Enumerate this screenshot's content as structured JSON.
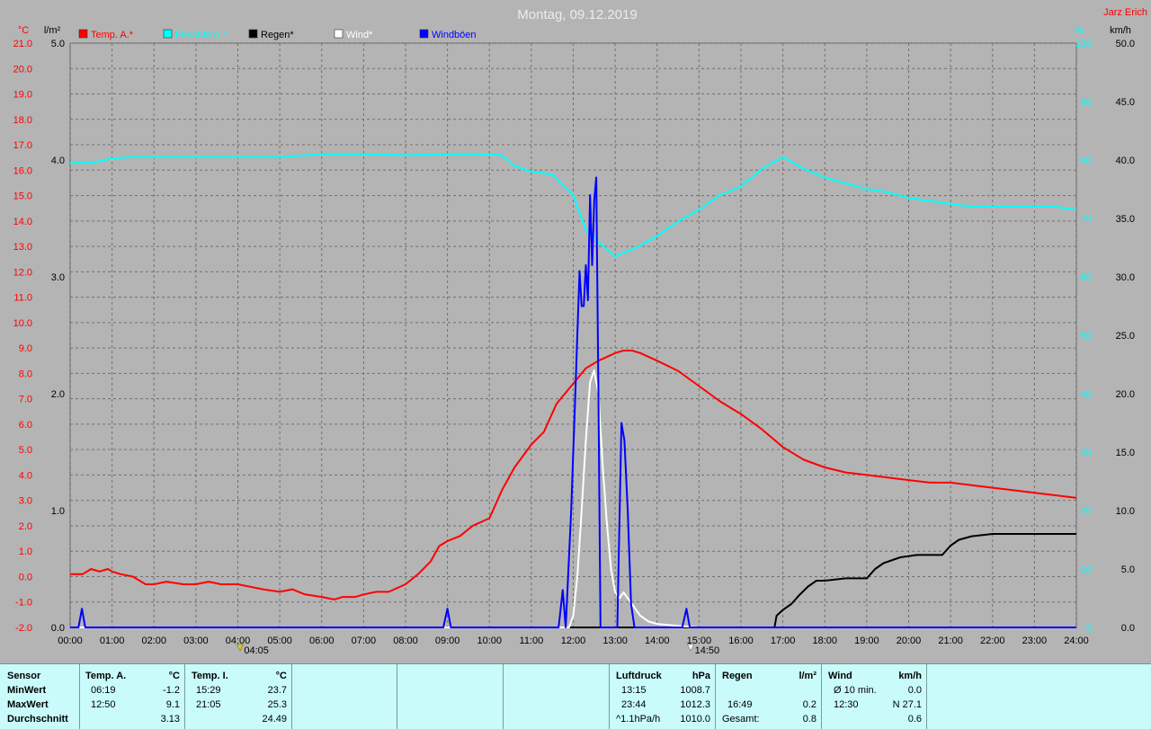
{
  "header": {
    "title": "Montag, 09.12.2019",
    "author": "Jarz Erich"
  },
  "axes": {
    "left1_unit": "°C",
    "left2_unit": "l/m²",
    "right1_unit": "%",
    "right2_unit": "km/h"
  },
  "legend": [
    {
      "label": "Temp. A.*",
      "color": "#ff0000"
    },
    {
      "label": "Feuchte A.*",
      "color": "#00ffff"
    },
    {
      "label": "Regen*",
      "color": "#000000"
    },
    {
      "label": "Wind*",
      "color": "#ffffff"
    },
    {
      "label": "Windböen",
      "color": "#0000ff"
    }
  ],
  "markers": {
    "sunrise": "04:05",
    "sunset": "14:50"
  },
  "chart_data": {
    "type": "line",
    "x_unit": "hour",
    "xlim": [
      0,
      24
    ],
    "x_ticks": [
      "00:00",
      "01:00",
      "02:00",
      "03:00",
      "04:00",
      "05:00",
      "06:00",
      "07:00",
      "08:00",
      "09:00",
      "10:00",
      "11:00",
      "12:00",
      "13:00",
      "14:00",
      "15:00",
      "16:00",
      "17:00",
      "18:00",
      "19:00",
      "20:00",
      "21:00",
      "22:00",
      "23:00",
      "24:00"
    ],
    "axis_temp": {
      "unit": "°C",
      "ylim": [
        -2,
        21
      ],
      "ticks": [
        "-2.0",
        "-1.0",
        "0.0",
        "1.0",
        "2.0",
        "3.0",
        "4.0",
        "5.0",
        "6.0",
        "7.0",
        "8.0",
        "9.0",
        "10.0",
        "11.0",
        "12.0",
        "13.0",
        "14.0",
        "15.0",
        "16.0",
        "17.0",
        "18.0",
        "19.0",
        "20.0",
        "21.0"
      ]
    },
    "axis_rain": {
      "unit": "l/m²",
      "ylim": [
        0,
        5
      ],
      "ticks": [
        "0.0",
        "1.0",
        "2.0",
        "3.0",
        "4.0",
        "5.0"
      ]
    },
    "axis_humidity": {
      "unit": "%",
      "ylim": [
        0,
        100
      ],
      "ticks": [
        "0",
        "10",
        "20",
        "30",
        "40",
        "50",
        "60",
        "70",
        "80",
        "90",
        "100"
      ]
    },
    "axis_wind": {
      "unit": "km/h",
      "ylim": [
        0,
        50
      ],
      "ticks": [
        "0.0",
        "5.0",
        "10.0",
        "15.0",
        "20.0",
        "25.0",
        "30.0",
        "35.0",
        "40.0",
        "45.0",
        "50.0"
      ]
    },
    "series": [
      {
        "name": "Temp. A.*",
        "color": "#ff0000",
        "axis": "axis_temp",
        "x": [
          0,
          0.3,
          0.5,
          0.7,
          0.9,
          1.0,
          1.2,
          1.5,
          1.8,
          2.0,
          2.3,
          2.7,
          3.0,
          3.3,
          3.6,
          4.0,
          4.3,
          4.6,
          5.0,
          5.3,
          5.6,
          6.0,
          6.3,
          6.5,
          6.8,
          7.0,
          7.3,
          7.6,
          8.0,
          8.3,
          8.6,
          8.8,
          9.0,
          9.3,
          9.6,
          10.0,
          10.3,
          10.6,
          11.0,
          11.3,
          11.6,
          12.0,
          12.3,
          12.6,
          13.0,
          13.2,
          13.4,
          13.6,
          14.0,
          14.5,
          15.0,
          15.5,
          16.0,
          16.5,
          17.0,
          17.5,
          18.0,
          18.5,
          19.0,
          19.5,
          20.0,
          20.5,
          21.0,
          21.5,
          22.0,
          22.5,
          23.0,
          23.5,
          24.0
        ],
        "y": [
          0.1,
          0.1,
          0.3,
          0.2,
          0.3,
          0.2,
          0.1,
          0.0,
          -0.3,
          -0.3,
          -0.2,
          -0.3,
          -0.3,
          -0.2,
          -0.3,
          -0.3,
          -0.4,
          -0.5,
          -0.6,
          -0.5,
          -0.7,
          -0.8,
          -0.9,
          -0.8,
          -0.8,
          -0.7,
          -0.6,
          -0.6,
          -0.3,
          0.1,
          0.6,
          1.2,
          1.4,
          1.6,
          2.0,
          2.3,
          3.4,
          4.3,
          5.2,
          5.7,
          6.8,
          7.6,
          8.2,
          8.5,
          8.8,
          8.9,
          8.9,
          8.8,
          8.5,
          8.1,
          7.5,
          6.9,
          6.4,
          5.8,
          5.1,
          4.6,
          4.3,
          4.1,
          4.0,
          3.9,
          3.8,
          3.7,
          3.7,
          3.6,
          3.5,
          3.4,
          3.3,
          3.2,
          3.1
        ]
      },
      {
        "name": "Feuchte A.*",
        "color": "#00ffff",
        "axis": "axis_humidity",
        "x": [
          0,
          0.5,
          1.0,
          1.5,
          2.0,
          3.0,
          4.0,
          5.0,
          6.0,
          6.5,
          7.0,
          8.0,
          9.0,
          10.0,
          10.3,
          10.6,
          11.0,
          11.5,
          12.0,
          12.3,
          12.6,
          13.0,
          13.5,
          14.0,
          14.5,
          15.0,
          15.5,
          16.0,
          16.5,
          17.0,
          17.5,
          18.0,
          18.5,
          19.0,
          19.5,
          20.0,
          20.5,
          21.0,
          21.5,
          22.0,
          22.5,
          23.0,
          23.5,
          24.0
        ],
        "y": [
          79.5,
          79.5,
          80.3,
          80.5,
          80.5,
          80.5,
          80.5,
          80.5,
          81.0,
          81.0,
          81.0,
          80.8,
          81.0,
          81.0,
          80.8,
          79.0,
          78.0,
          77.5,
          74.0,
          68.0,
          66.0,
          63.5,
          65.0,
          67.0,
          69.5,
          71.5,
          74.0,
          75.5,
          78.5,
          80.5,
          78.5,
          77.0,
          76.0,
          75.0,
          74.5,
          73.5,
          73.0,
          72.5,
          72.0,
          72.0,
          72.0,
          72.0,
          72.0,
          71.5
        ]
      },
      {
        "name": "Regen*",
        "color": "#000000",
        "axis": "axis_rain",
        "x": [
          0,
          16.8,
          16.85,
          17.0,
          17.2,
          17.4,
          17.6,
          17.8,
          18.0,
          18.5,
          19.0,
          19.2,
          19.4,
          19.8,
          20.2,
          20.8,
          21.0,
          21.2,
          21.5,
          22.0,
          23.0,
          24.0
        ],
        "y": [
          0,
          0,
          0.1,
          0.15,
          0.2,
          0.28,
          0.35,
          0.4,
          0.4,
          0.42,
          0.42,
          0.5,
          0.55,
          0.6,
          0.62,
          0.62,
          0.7,
          0.75,
          0.78,
          0.8,
          0.8,
          0.8
        ]
      },
      {
        "name": "Wind*",
        "color": "#ffffff",
        "axis": "axis_wind",
        "x": [
          0,
          11.9,
          12.0,
          12.1,
          12.2,
          12.3,
          12.4,
          12.5,
          12.6,
          12.7,
          12.8,
          12.9,
          13.0,
          13.1,
          13.2,
          13.3,
          13.4,
          13.5,
          13.6,
          13.8,
          14.0,
          14.3,
          14.6,
          15.0,
          24.0
        ],
        "y": [
          0,
          0,
          1.0,
          4.5,
          10.0,
          16.0,
          21.0,
          22.0,
          20.0,
          14.0,
          9.0,
          5.0,
          3.0,
          2.5,
          3.0,
          2.5,
          2.0,
          1.5,
          1.0,
          0.5,
          0.3,
          0.2,
          0.1,
          0,
          0
        ]
      },
      {
        "name": "Windböen",
        "color": "#0000ff",
        "axis": "axis_wind",
        "x": [
          0,
          0.2,
          0.28,
          0.36,
          0.45,
          8.9,
          9.0,
          9.08,
          9.17,
          11.65,
          11.75,
          11.82,
          11.95,
          12.05,
          12.15,
          12.2,
          12.25,
          12.3,
          12.35,
          12.4,
          12.45,
          12.5,
          12.55,
          12.6,
          12.65,
          12.75,
          12.85,
          12.95,
          13.05,
          13.15,
          13.22,
          13.3,
          13.38,
          13.46,
          13.55,
          13.65,
          14.6,
          14.7,
          14.78,
          14.85,
          24.0
        ],
        "y": [
          0,
          0,
          1.6,
          0,
          0,
          0,
          1.6,
          0,
          0,
          0,
          3.2,
          0,
          10.0,
          20.0,
          30.5,
          27.5,
          27.5,
          31.0,
          28.0,
          37.0,
          31.0,
          36.5,
          38.5,
          20.0,
          0,
          0,
          0,
          0,
          0,
          17.5,
          16.0,
          10.0,
          2.0,
          0,
          0,
          0,
          0,
          1.6,
          0,
          0,
          0
        ]
      }
    ]
  },
  "summary": {
    "sensor": {
      "header": "Sensor",
      "rows": [
        "MinWert",
        "MaxWert",
        "Durchschnitt"
      ]
    },
    "temp_a": {
      "header": "Temp. A.",
      "unit": "°C",
      "min_time": "06:19",
      "min_val": "-1.2",
      "max_time": "12:50",
      "max_val": "9.1",
      "avg": "3.13"
    },
    "temp_i": {
      "header": "Temp. I.",
      "unit": "°C",
      "min_time": "15:29",
      "min_val": "23.7",
      "max_time": "21:05",
      "max_val": "25.3",
      "avg": "24.49"
    },
    "pressure": {
      "header": "Luftdruck",
      "unit": "hPa",
      "min_time": "13:15",
      "min_val": "1008.7",
      "max_time": "23:44",
      "max_val": "1012.3",
      "trend_label": "^1.1hPa/h",
      "trend_val": "1010.0"
    },
    "rain": {
      "header": "Regen",
      "unit": "l/m²",
      "max_time": "16:49",
      "max_val": "0.2",
      "total_label": "Gesamt:",
      "total_val": "0.8"
    },
    "wind": {
      "header": "Wind",
      "unit": "km/h",
      "avg_label": "Ø 10 min.",
      "avg_val": "0.0",
      "max_time": "12:30",
      "max_val": "N 27.1",
      "day_avg": "0.6"
    }
  }
}
